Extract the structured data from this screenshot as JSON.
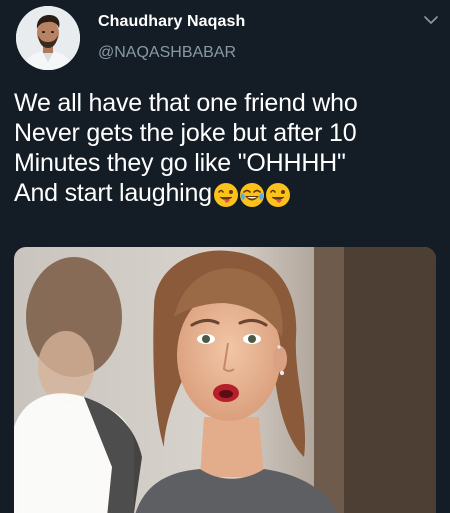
{
  "tweet": {
    "user": {
      "display_name": "Chaudhary Naqash",
      "handle": "@NAQASHBABAR"
    },
    "text_lines": [
      "We all have that one friend who",
      "Never gets the joke but after 10",
      "Minutes they go like \"OHHHH\"",
      "And start laughing"
    ],
    "emojis": [
      "winking-tongue-emoji",
      "tears-of-joy-emoji",
      "winking-tongue-emoji"
    ],
    "media": {
      "description_icon": "photo-of-surprised-woman"
    }
  },
  "colors": {
    "background": "#141d26",
    "text_primary": "#ffffff",
    "text_secondary": "#8899a6"
  }
}
